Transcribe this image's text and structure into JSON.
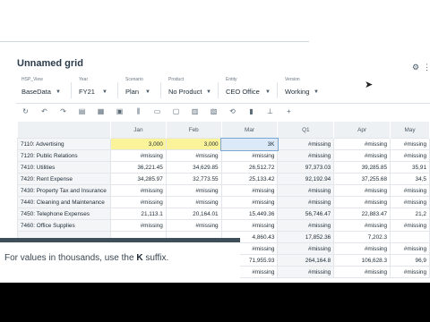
{
  "grid_title": "Unnamed grid",
  "pov": [
    {
      "label": "HSP_View",
      "value": "BaseData"
    },
    {
      "label": "Year",
      "value": "FY21"
    },
    {
      "label": "Scenario",
      "value": "Plan"
    },
    {
      "label": "Product",
      "value": "No Product"
    },
    {
      "label": "Entity",
      "value": "CEO Office"
    },
    {
      "label": "Version",
      "value": "Working"
    }
  ],
  "toolbar_icons": [
    "refresh-icon",
    "undo-icon",
    "redo-icon",
    "copy-icon",
    "paste-icon",
    "cut-icon",
    "columns-icon",
    "comment-icon",
    "attachment-icon",
    "adjust-icon",
    "details-icon",
    "history-icon",
    "lock-icon",
    "clear-icon",
    "add-icon"
  ],
  "columns": [
    "",
    "Jan",
    "Feb",
    "Mar",
    "Q1",
    "Apr",
    "May"
  ],
  "rows": [
    {
      "account": "7110: Advertising",
      "cells": [
        "3,000",
        "3,000",
        "3K",
        "#missing",
        "#missing",
        "#missing"
      ]
    },
    {
      "account": "7120: Public Relations",
      "cells": [
        "#missing",
        "#missing",
        "#missing",
        "#missing",
        "#missing",
        "#missing"
      ]
    },
    {
      "account": "7410: Utilities",
      "cells": [
        "36,221.45",
        "34,629.85",
        "26,512.72",
        "97,373.03",
        "39,285.85",
        "35,91"
      ]
    },
    {
      "account": "7420: Rent Expense",
      "cells": [
        "34,285.97",
        "32,773.55",
        "25,133.42",
        "92,192.94",
        "37,255.68",
        "34,5"
      ]
    },
    {
      "account": "7430: Property Tax and Insurance",
      "cells": [
        "#missing",
        "#missing",
        "#missing",
        "#missing",
        "#missing",
        "#missing"
      ]
    },
    {
      "account": "7440: Cleaning and Maintenance",
      "cells": [
        "#missing",
        "#missing",
        "#missing",
        "#missing",
        "#missing",
        "#missing"
      ]
    },
    {
      "account": "7450: Telephone Expenses",
      "cells": [
        "21,113.1",
        "20,164.01",
        "15,449.36",
        "56,746.47",
        "22,883.47",
        "21,2"
      ]
    },
    {
      "account": "7460: Office Supplies",
      "cells": [
        "#missing",
        "#missing",
        "#missing",
        "#missing",
        "#missing",
        "#missing"
      ]
    },
    {
      "account": "",
      "cells": [
        "",
        "",
        "4,860.43",
        "17,852.36",
        "7,202.3",
        ""
      ]
    },
    {
      "account": "",
      "cells": [
        "",
        "",
        "#missing",
        "#missing",
        "#missing",
        "#missing"
      ]
    },
    {
      "account": "",
      "cells": [
        "",
        "",
        "71,955.93",
        "264,164.8",
        "106,628.3",
        "96,9"
      ]
    },
    {
      "account": "",
      "cells": [
        "",
        "",
        "#missing",
        "#missing",
        "#missing",
        "#missing"
      ]
    }
  ],
  "caption": {
    "prefix": "For values in thousands, use the ",
    "key": "K",
    "suffix": " suffix."
  },
  "colors": {
    "input_cell": "#fbf39a",
    "selected_cell": "#dbe9f8",
    "header_bg": "#eef1f4"
  }
}
